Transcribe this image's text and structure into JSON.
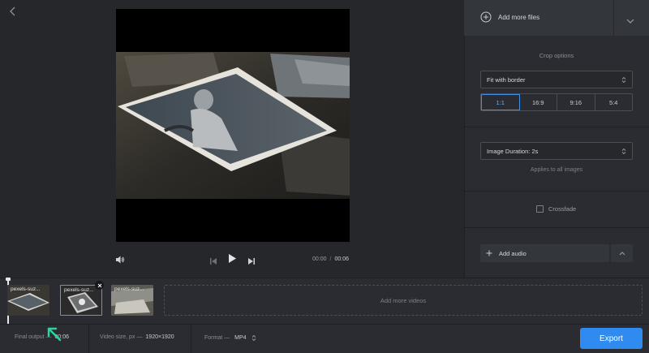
{
  "player": {
    "time_current": "00:00",
    "time_separator": "/",
    "time_total": "00:06"
  },
  "panel": {
    "add_files_label": "Add more files",
    "crop_title": "Crop options",
    "crop_mode": "Fit with border",
    "ratios": [
      "1:1",
      "16:9",
      "9:16",
      "5:4"
    ],
    "active_ratio": "1:1",
    "duration_label": "Image Duration: 2s",
    "duration_note": "Applies to all images",
    "crossfade_label": "Crossfade",
    "add_audio_label": "Add audio"
  },
  "timeline": {
    "thumbs": [
      "pexels-suz...",
      "pexels-suz...",
      "pexels-suz..."
    ],
    "add_more_label": "Add more videos"
  },
  "bottom": {
    "final_output_label": "Final output —",
    "final_output_value": "00:06",
    "video_size_label": "Video size, px —",
    "video_size_value": "1920×1920",
    "format_label": "Format —",
    "format_value": "MP4",
    "export_label": "Export"
  },
  "colors": {
    "accent": "#2f8bf0",
    "arrow": "#2ed3a0"
  }
}
